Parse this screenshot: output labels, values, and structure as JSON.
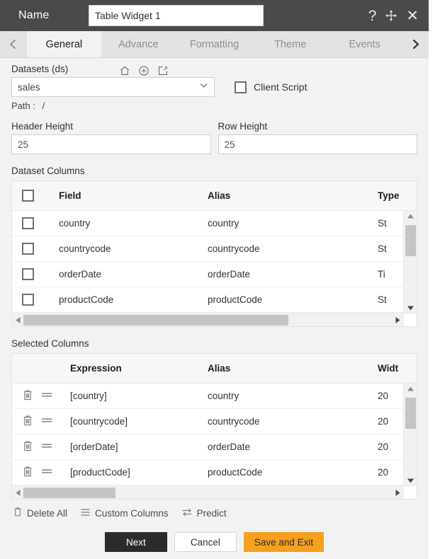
{
  "titlebar": {
    "name_label": "Name",
    "widget_name": "Table Widget 1",
    "widget_name_placeholder": "Widget name",
    "help_icon": "question-mark-icon",
    "move_icon": "move-arrows-icon",
    "close_icon": "close-x-icon"
  },
  "tabs": {
    "prev_icon": "chevron-left-icon",
    "next_icon": "chevron-right-icon",
    "items": [
      {
        "label": "General",
        "active": true
      },
      {
        "label": "Advance",
        "active": false
      },
      {
        "label": "Formatting",
        "active": false
      },
      {
        "label": "Theme",
        "active": false
      },
      {
        "label": "Events",
        "active": false
      }
    ]
  },
  "general": {
    "datasets_label": "Datasets (ds)",
    "dataset_icons": [
      "home-icon",
      "plus-circle-icon",
      "edit-pencil-icon"
    ],
    "dataset_selected": "sales",
    "dataset_chevron": "chevron-down-icon",
    "client_script_label": "Client Script",
    "client_script_checked": false,
    "path_label": "Path :",
    "path_value": "/",
    "header_height_label": "Header Height",
    "header_height_value": "25",
    "row_height_label": "Row Height",
    "row_height_value": "25"
  },
  "dataset_columns": {
    "title": "Dataset Columns",
    "select_all_checked": false,
    "headers": [
      "",
      "Field",
      "Alias",
      "Type"
    ],
    "rows": [
      {
        "checked": false,
        "field": "country",
        "alias": "country",
        "type": "St"
      },
      {
        "checked": false,
        "field": "countrycode",
        "alias": "countrycode",
        "type": "St"
      },
      {
        "checked": false,
        "field": "orderDate",
        "alias": "orderDate",
        "type": "Ti"
      },
      {
        "checked": false,
        "field": "productCode",
        "alias": "productCode",
        "type": "St"
      }
    ]
  },
  "selected_columns": {
    "title": "Selected Columns",
    "headers": [
      "",
      "",
      "Expression",
      "Alias",
      "Widt"
    ],
    "delete_icon": "trash-icon",
    "drag_icon": "drag-handle-icon",
    "rows": [
      {
        "expression": "[country]",
        "alias": "country",
        "width": "20"
      },
      {
        "expression": "[countrycode]",
        "alias": "countrycode",
        "width": "20"
      },
      {
        "expression": "[orderDate]",
        "alias": "orderDate",
        "width": "20"
      },
      {
        "expression": "[productCode]",
        "alias": "productCode",
        "width": "20"
      }
    ]
  },
  "toolbar": {
    "delete_all_label": "Delete All",
    "delete_all_icon": "trash-icon",
    "custom_columns_label": "Custom Columns",
    "custom_columns_icon": "list-lines-icon",
    "predict_label": "Predict",
    "predict_icon": "swap-arrows-icon"
  },
  "actions": {
    "next_label": "Next",
    "cancel_label": "Cancel",
    "save_label": "Save and Exit",
    "save_color": "#f5a01e",
    "next_color": "#2b2b2b"
  }
}
